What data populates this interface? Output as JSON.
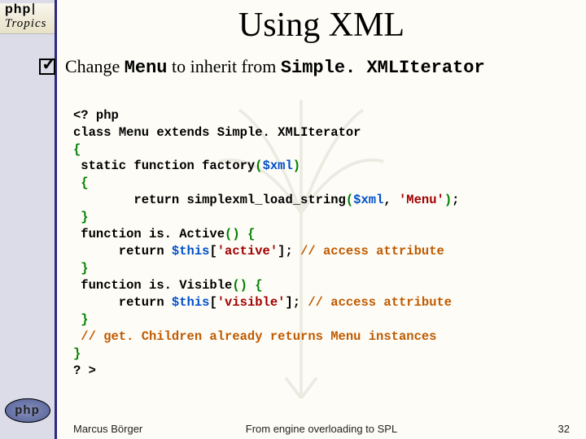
{
  "brand": {
    "top": "php",
    "bottom": "Tropics"
  },
  "logo_text": "php",
  "title": "Using XML",
  "bullet": {
    "pre": "Change ",
    "code1": "Menu",
    "mid": " to inherit from ",
    "code2": "Simple. XMLIterator"
  },
  "code": {
    "l1": "<? php",
    "l2a": "class ",
    "l2b": "Menu",
    "l2c": " extends ",
    "l2d": "Simple. XMLIterator",
    "l3": "{",
    "l4": " static function factory",
    "l4p": "(",
    "l4v": "$xml",
    "l4q": ")",
    "l5": " {",
    "l6a": "        return simplexml_load_string",
    "l6p": "(",
    "l6v": "$xml",
    "l6c": ", ",
    "l6s": "'Menu'",
    "l6q": ")",
    "l6e": ";",
    "l7": " }",
    "l8a": " function is. Active",
    "l8p": "()",
    "l8b": " {",
    "l9a": "      return ",
    "l9v": "$this",
    "l9b": "[",
    "l9s": "'active'",
    "l9c": "]; ",
    "l9cmt": "// access attribute",
    "l10": " }",
    "l11a": " function is. Visible",
    "l11p": "()",
    "l11b": " {",
    "l12a": "      return ",
    "l12v": "$this",
    "l12b": "[",
    "l12s": "'visible'",
    "l12c": "]; ",
    "l12cmt": "// access attribute",
    "l13": " }",
    "l14": " // get. Children already returns Menu instances",
    "l15": "}",
    "l16": "? >"
  },
  "footer": {
    "author": "Marcus Börger",
    "talk": "From engine overloading to SPL",
    "page": "32"
  }
}
